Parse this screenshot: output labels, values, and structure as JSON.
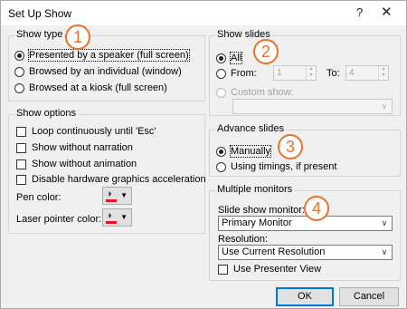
{
  "window": {
    "title": "Set Up Show",
    "help": "?",
    "close": "✕"
  },
  "show_type": {
    "label": "Show type",
    "options": [
      "Presented by a speaker (full screen)",
      "Browsed by an individual (window)",
      "Browsed at a kiosk (full screen)"
    ],
    "selected": 0
  },
  "show_options": {
    "label": "Show options",
    "checks": [
      "Loop continuously until 'Esc'",
      "Show without narration",
      "Show without animation",
      "Disable hardware graphics acceleration"
    ],
    "pen_color_label": "Pen color:",
    "laser_color_label": "Laser pointer color:",
    "pen_color": "#e81123",
    "laser_color": "#e81123"
  },
  "show_slides": {
    "label": "Show slides",
    "all": "All",
    "from": "From:",
    "from_value": "1",
    "to": "To:",
    "to_value": "4",
    "custom": "Custom show:"
  },
  "advance_slides": {
    "label": "Advance slides",
    "manual": "Manually",
    "timings": "Using timings, if present"
  },
  "monitors": {
    "label": "Multiple monitors",
    "slide_show_monitor_label": "Slide show monitor:",
    "slide_show_monitor_value": "Primary Monitor",
    "resolution_label": "Resolution:",
    "resolution_value": "Use Current Resolution",
    "presenter_view": "Use Presenter View"
  },
  "badges": [
    "1",
    "2",
    "3",
    "4"
  ],
  "buttons": {
    "ok": "OK",
    "cancel": "Cancel"
  },
  "colors": {
    "accent": "#e8732c",
    "default_button_border": "#0078d7"
  }
}
